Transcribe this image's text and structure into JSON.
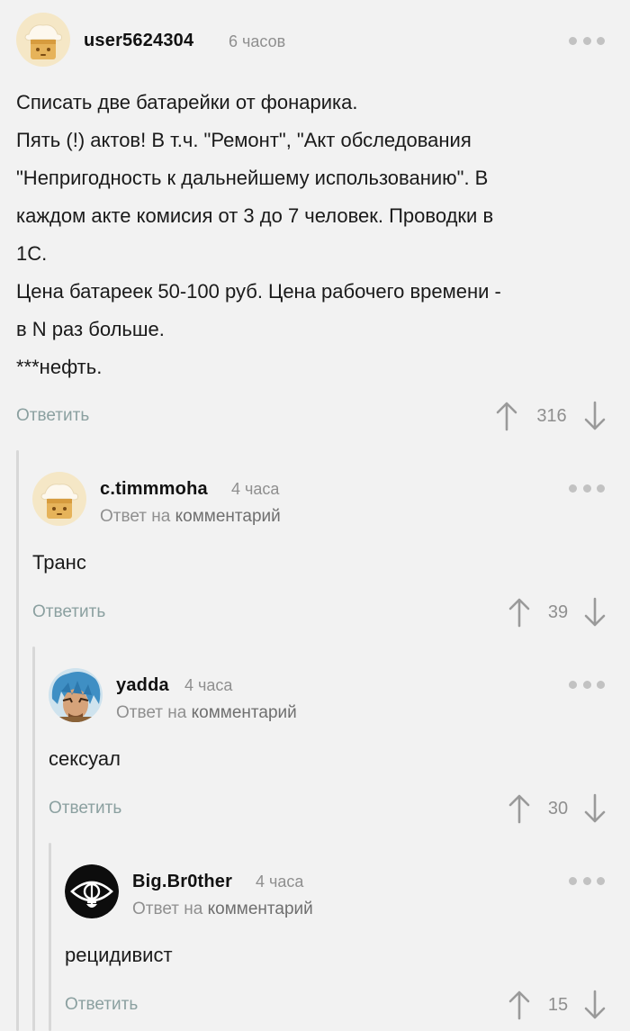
{
  "comments": [
    {
      "username": "user5624304",
      "time": "6 часов",
      "reply_to": null,
      "body_lines": [
        "Списать две батарейки от фонарика.",
        "Пять (!) актов! В т.ч. \"Ремонт\", \"Акт обследования",
        "\"Непригодность к дальнейшему использованию\". В",
        "каждом акте комисия от 3 до 7 человек. Проводки в",
        "1С.",
        "Цена батареек 50-100 руб. Цена рабочего времени -",
        "в N раз больше.",
        "***нефть."
      ],
      "reply_label": "Ответить",
      "rating": "316",
      "avatar": "default-cat-avatar"
    },
    {
      "username": "c.timmmoha",
      "time": "4 часа",
      "reply_to": {
        "prefix": "Ответ на",
        "link": "комментарий"
      },
      "body_lines": [
        "Транс"
      ],
      "reply_label": "Ответить",
      "rating": "39",
      "avatar": "default-cat-avatar"
    },
    {
      "username": "yadda",
      "time": "4 часа",
      "reply_to": {
        "prefix": "Ответ на",
        "link": "комментарий"
      },
      "body_lines": [
        "сексуал"
      ],
      "reply_label": "Ответить",
      "rating": "30",
      "avatar": "anime-character-avatar"
    },
    {
      "username": "Big.Br0ther",
      "time": "4 часа",
      "reply_to": {
        "prefix": "Ответ на",
        "link": "комментарий"
      },
      "body_lines": [
        "рецидивист"
      ],
      "reply_label": "Ответить",
      "rating": "15",
      "avatar": "eye-logo-avatar"
    }
  ],
  "icons": {
    "more": "more-dots-icon",
    "upvote": "arrow-up-icon",
    "downvote": "arrow-down-icon"
  },
  "colors": {
    "background": "#f2f2f2",
    "text": "#1a1a1a",
    "muted": "#8f8f8f",
    "reply_link": "#8ba0a0",
    "thread_line": "#d8d8d8"
  }
}
